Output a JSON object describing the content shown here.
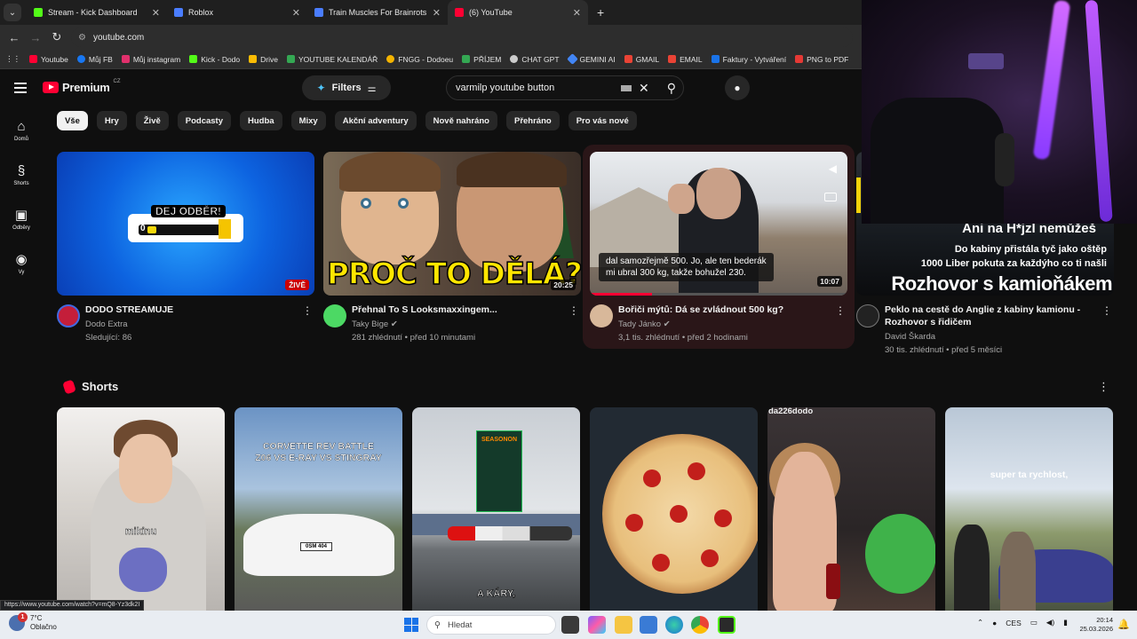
{
  "browser": {
    "tabs": [
      {
        "label": "Stream - Kick Dashboard",
        "color": "#53fc18"
      },
      {
        "label": "Roblox",
        "color": "#4a7dff"
      },
      {
        "label": "Train Muscles For Brainrots",
        "color": "#4a7dff"
      },
      {
        "label": "(6) YouTube",
        "color": "#ff0033"
      }
    ],
    "url": "youtube.com",
    "bookmarks": [
      {
        "label": "Youtube",
        "color": "#ff0033"
      },
      {
        "label": "Můj FB",
        "color": "#1877f2"
      },
      {
        "label": "Můj instagram",
        "color": "#e1306c"
      },
      {
        "label": "Kick - Dodo",
        "color": "#53fc18"
      },
      {
        "label": "Drive",
        "color": "#fbbc04"
      },
      {
        "label": "YOUTUBE KALENDÁŘ",
        "color": "#34a853"
      },
      {
        "label": "FNGG - Dodoeu",
        "color": "#f4b400"
      },
      {
        "label": "PŘÍJEM",
        "color": "#34a853"
      },
      {
        "label": "CHAT GPT",
        "color": "#cccccc"
      },
      {
        "label": "GEMINI AI",
        "color": "#4285f4"
      },
      {
        "label": "GMAIL",
        "color": "#ea4335"
      },
      {
        "label": "EMAIL",
        "color": "#ea4335"
      },
      {
        "label": "Faktury - Vytváření",
        "color": "#1a73e8"
      },
      {
        "label": "PNG to PDF",
        "color": "#e53935"
      }
    ]
  },
  "youtube": {
    "logo_text": "Premium",
    "region": "CZ",
    "filters_label": "Filters",
    "search_query": "varmilp youtube button",
    "sidebar": [
      {
        "label": "Domů",
        "icon": "home-icon"
      },
      {
        "label": "Shorts",
        "icon": "shorts-icon"
      },
      {
        "label": "Odběry",
        "icon": "subscriptions-icon"
      },
      {
        "label": "Vy",
        "icon": "you-icon"
      }
    ],
    "chips": [
      "Vše",
      "Hry",
      "Živě",
      "Podcasty",
      "Hudba",
      "Mixy",
      "Akční adventury",
      "Nově nahráno",
      "Přehráno",
      "Pro vás nové"
    ],
    "videos": [
      {
        "title": "DODO STREAMUJE",
        "channel": "Dodo Extra",
        "stats": "Sledující: 86",
        "badge": "ŽIVĚ",
        "thumb_text": "DEJ ODBĚR!",
        "thumb_counter": "0"
      },
      {
        "title": "Přehnal To S Looksmaxxingem...",
        "channel": "Taky Bige",
        "stats": "281 zhlédnutí • před 10 minutami",
        "duration": "20:25",
        "thumb_text": "PROČ TO DĚLÁ?"
      },
      {
        "title": "Bořiči mýtů: Dá se zvládnout 500 kg?",
        "channel": "Tady Jánko",
        "stats": "3,1 tis. zhlédnutí • před 2 hodinami",
        "duration": "10:07",
        "caption_line1": "dal samozřejmě 500. Jo, ale ten bederák",
        "caption_line2": "mi ubral 300 kg, takže bohužel 230.",
        "progress": 0.24
      },
      {
        "title_line1": "Peklo na cestě do Anglie z kabiny kamionu -",
        "title_line2": "Rozhovor s řidičem",
        "channel": "David Škarda",
        "stats": "30 tis. zhlédnutí • před 5 měsíci",
        "thumb_line1": "Ani na H*jzl nemůžeš",
        "thumb_line2": "Do kabiny přistála tyč jako oštěp",
        "thumb_line3": "1000 Liber pokuta za každýho co ti našli",
        "thumb_line4": "Rozhovor s kamioňákem"
      }
    ],
    "shorts_title": "Shorts",
    "shorts": [
      {
        "overlay": "mikinu"
      },
      {
        "overlay_line1": "CORVETTE REV BATTLE",
        "overlay_line2": "Z06 VS E-RAY VS STINGRAY",
        "plate": "0SM 404"
      },
      {
        "overlay": "A KÁRY,",
        "poster": "SEASONON"
      },
      {
        "overlay": ""
      },
      {
        "channel": "da226dodo"
      },
      {
        "overlay": "super ta rychlost,"
      }
    ],
    "status_url": "https://www.youtube.com/watch?v=mQ8-Yz3dk2I"
  },
  "taskbar": {
    "temperature": "7°C",
    "weather": "Oblačno",
    "notifications": "1",
    "search_placeholder": "Hledat",
    "lang": "CES",
    "time": "20:14",
    "date": "25.03.2026"
  }
}
